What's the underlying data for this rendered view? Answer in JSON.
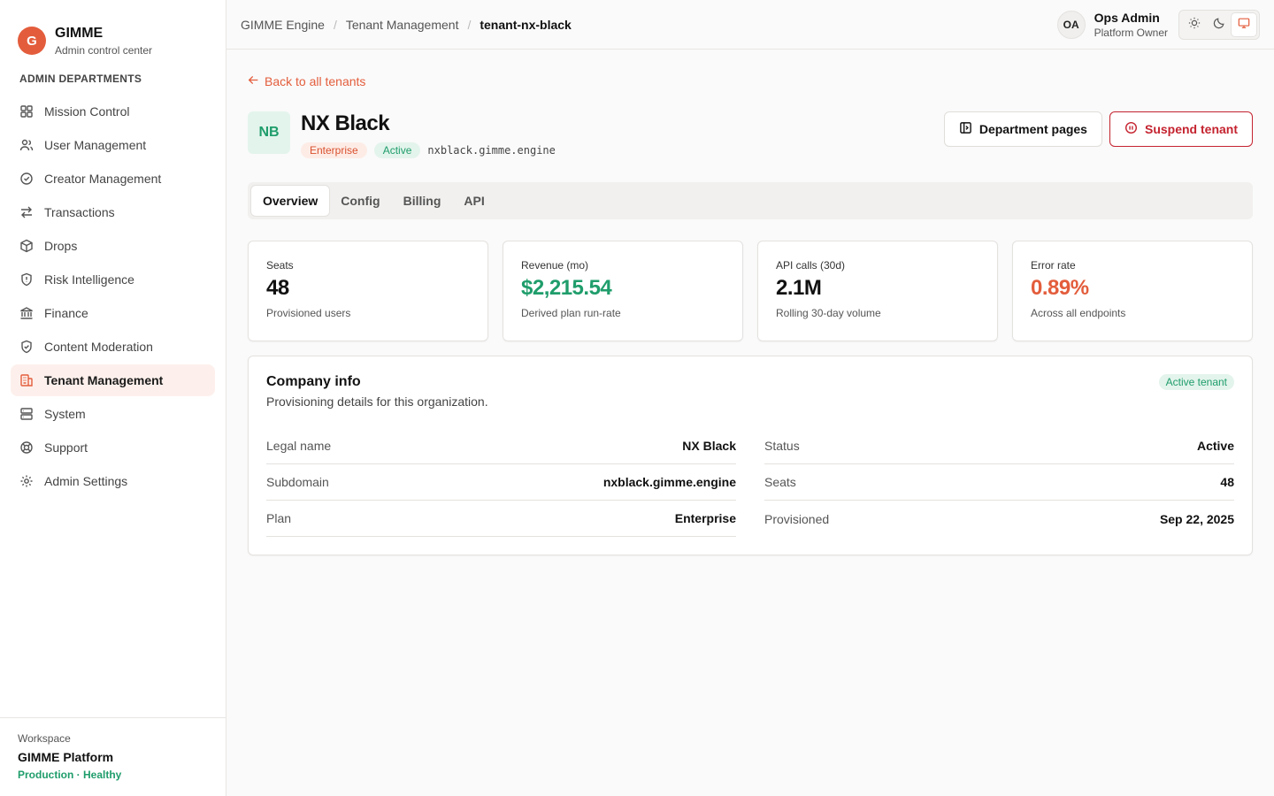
{
  "brand": {
    "logo_letter": "G",
    "name": "GIMME",
    "subtitle": "Admin control center"
  },
  "sidebar": {
    "section_title": "ADMIN DEPARTMENTS",
    "items": [
      {
        "label": "Mission Control",
        "icon": "grid-icon"
      },
      {
        "label": "User Management",
        "icon": "users-icon"
      },
      {
        "label": "Creator Management",
        "icon": "check-circle-icon"
      },
      {
        "label": "Transactions",
        "icon": "arrows-swap-icon"
      },
      {
        "label": "Drops",
        "icon": "box-icon"
      },
      {
        "label": "Risk Intelligence",
        "icon": "shield-alert-icon"
      },
      {
        "label": "Finance",
        "icon": "bank-icon"
      },
      {
        "label": "Content Moderation",
        "icon": "shield-check-icon"
      },
      {
        "label": "Tenant Management",
        "icon": "building-icon",
        "active": true
      },
      {
        "label": "System",
        "icon": "server-icon"
      },
      {
        "label": "Support",
        "icon": "lifebuoy-icon"
      },
      {
        "label": "Admin Settings",
        "icon": "gear-icon"
      }
    ],
    "workspace": {
      "label": "Workspace",
      "name": "GIMME Platform",
      "status": "Production · Healthy"
    }
  },
  "topbar": {
    "breadcrumbs": [
      "GIMME Engine",
      "Tenant Management",
      "tenant-nx-black"
    ],
    "user": {
      "initials": "OA",
      "name": "Ops Admin",
      "role": "Platform Owner"
    },
    "theme_modes": [
      "light",
      "dark",
      "system"
    ],
    "active_theme": "system"
  },
  "page": {
    "back_link": "Back to all tenants",
    "tenant": {
      "initials": "NB",
      "name": "NX Black",
      "plan_tag": "Enterprise",
      "status_tag": "Active",
      "domain": "nxblack.gimme.engine"
    },
    "actions": {
      "department_pages": "Department pages",
      "suspend": "Suspend tenant"
    },
    "tabs": [
      "Overview",
      "Config",
      "Billing",
      "API"
    ],
    "active_tab": "Overview",
    "stats": [
      {
        "label": "Seats",
        "value": "48",
        "sub": "Provisioned users",
        "tone": "default"
      },
      {
        "label": "Revenue (mo)",
        "value": "$2,215.54",
        "sub": "Derived plan run-rate",
        "tone": "green"
      },
      {
        "label": "API calls (30d)",
        "value": "2.1M",
        "sub": "Rolling 30-day volume",
        "tone": "default"
      },
      {
        "label": "Error rate",
        "value": "0.89%",
        "sub": "Across all endpoints",
        "tone": "orange"
      }
    ],
    "company": {
      "title": "Company info",
      "description": "Provisioning details for this organization.",
      "badge": "Active tenant",
      "left": [
        {
          "key": "Legal name",
          "value": "NX Black"
        },
        {
          "key": "Subdomain",
          "value": "nxblack.gimme.engine"
        },
        {
          "key": "Plan",
          "value": "Enterprise"
        }
      ],
      "right": [
        {
          "key": "Status",
          "value": "Active"
        },
        {
          "key": "Seats",
          "value": "48"
        },
        {
          "key": "Provisioned",
          "value": "Sep 22, 2025"
        }
      ]
    }
  },
  "colors": {
    "accent": "#e35d3c",
    "success": "#1f9d6b",
    "danger": "#c4232f"
  }
}
